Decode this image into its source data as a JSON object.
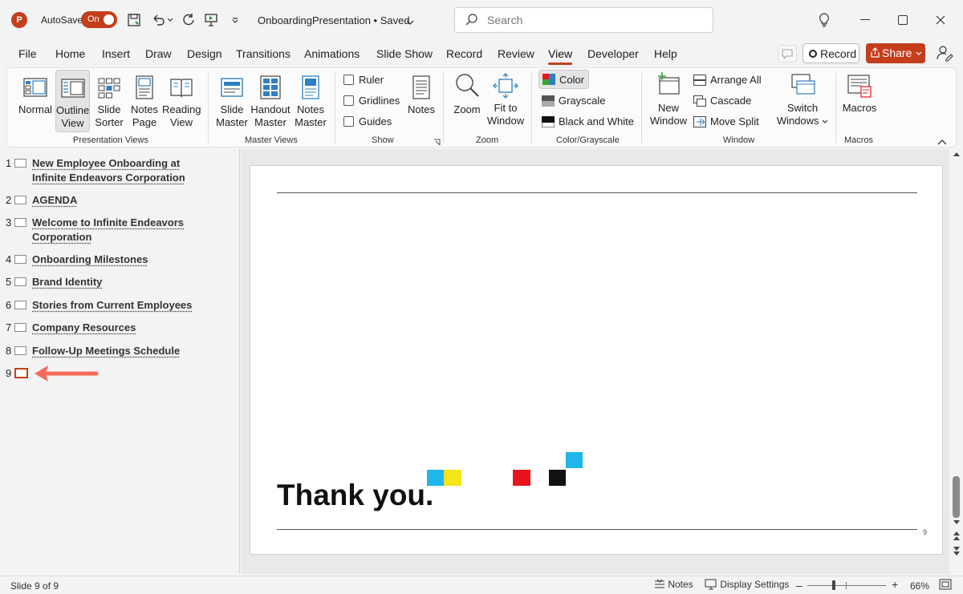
{
  "titlebar": {
    "autosave_label": "AutoSave",
    "autosave_state": "On",
    "document_title": "OnboardingPresentation • Saved",
    "search_placeholder": "Search"
  },
  "menu": {
    "tabs": [
      "File",
      "Home",
      "Insert",
      "Draw",
      "Design",
      "Transitions",
      "Animations",
      "Slide Show",
      "Record",
      "Review",
      "View",
      "Developer",
      "Help"
    ],
    "active_tab": "View",
    "record_label": "Record",
    "share_label": "Share"
  },
  "ribbon": {
    "presentation_views": {
      "label": "Presentation Views",
      "normal": "Normal",
      "outline": [
        "Outline",
        "View"
      ],
      "slide_sorter": [
        "Slide",
        "Sorter"
      ],
      "notes_page": [
        "Notes",
        "Page"
      ],
      "reading_view": [
        "Reading",
        "View"
      ]
    },
    "master_views": {
      "label": "Master Views",
      "slide_master": [
        "Slide",
        "Master"
      ],
      "handout_master": [
        "Handout",
        "Master"
      ],
      "notes_master": [
        "Notes",
        "Master"
      ]
    },
    "show": {
      "label": "Show",
      "ruler": "Ruler",
      "gridlines": "Gridlines",
      "guides": "Guides",
      "notes": "Notes"
    },
    "zoom": {
      "label": "Zoom",
      "zoom": "Zoom",
      "fit_to_window": [
        "Fit to",
        "Window"
      ]
    },
    "color": {
      "label": "Color/Grayscale",
      "color": "Color",
      "grayscale": "Grayscale",
      "black_white": "Black and White"
    },
    "window": {
      "label": "Window",
      "new_window": [
        "New",
        "Window"
      ],
      "arrange_all": "Arrange All",
      "cascade": "Cascade",
      "move_split": "Move Split",
      "switch_windows": [
        "Switch",
        "Windows"
      ]
    },
    "macros": {
      "label": "Macros",
      "macros": "Macros"
    }
  },
  "outline": {
    "items": [
      {
        "num": "1",
        "title": "New Employee Onboarding at Infinite Endeavors Corporation"
      },
      {
        "num": "2",
        "title": "AGENDA"
      },
      {
        "num": "3",
        "title": "Welcome to Infinite Endeavors Corporation"
      },
      {
        "num": "4",
        "title": "Onboarding Milestones"
      },
      {
        "num": "5",
        "title": "Brand Identity"
      },
      {
        "num": "6",
        "title": "Stories from Current Employees"
      },
      {
        "num": "7",
        "title": "Company Resources"
      },
      {
        "num": "8",
        "title": "Follow-Up Meetings Schedule"
      },
      {
        "num": "9",
        "title": ""
      }
    ]
  },
  "slide": {
    "title": "Thank you.",
    "page_number": "9"
  },
  "statusbar": {
    "slide_info": "Slide 9 of 9",
    "notes": "Notes",
    "display_settings": "Display Settings",
    "zoom_level": "66%",
    "minus": "–",
    "plus": "+"
  },
  "colors": {
    "accent": "#c43e1c",
    "arrow": "#f26b5b",
    "cyan": "#1fb6ea",
    "yellow": "#f5e416",
    "red": "#e8141c",
    "black": "#111111"
  }
}
